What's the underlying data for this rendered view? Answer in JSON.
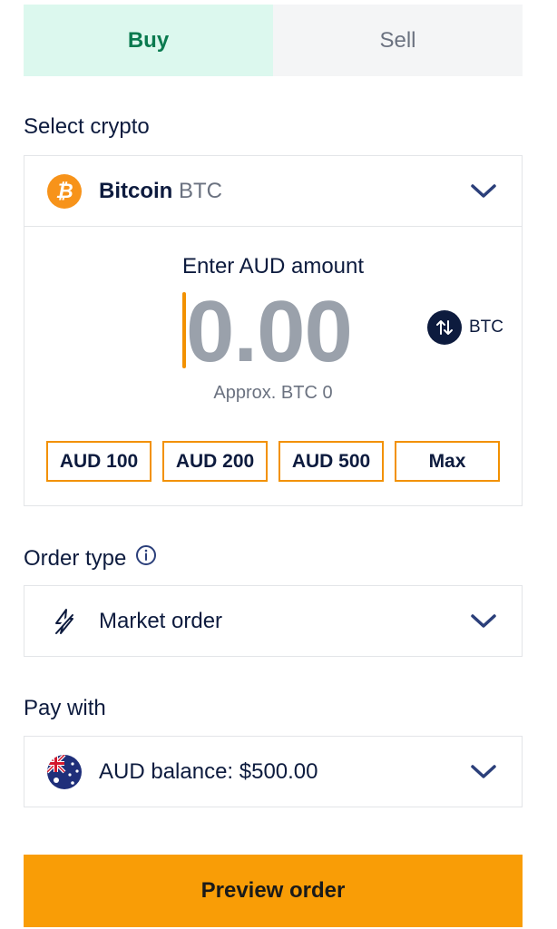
{
  "tabs": {
    "buy": "Buy",
    "sell": "Sell",
    "active": "buy"
  },
  "select_crypto": {
    "label": "Select crypto",
    "name": "Bitcoin",
    "symbol": "BTC",
    "icon": "bitcoin-icon"
  },
  "amount": {
    "label": "Enter AUD amount",
    "value": "0.00",
    "toggle_label": "BTC",
    "approx": "Approx. BTC 0",
    "quick_options": [
      "AUD 100",
      "AUD 200",
      "AUD 500",
      "Max"
    ]
  },
  "order_type": {
    "label": "Order type",
    "value": "Market order",
    "icon": "lightning-icon"
  },
  "pay_with": {
    "label": "Pay with",
    "value": "AUD balance: $500.00",
    "icon": "australia-flag-icon"
  },
  "preview_button": "Preview order",
  "colors": {
    "accent": "#f99d06",
    "buy_bg": "#dcf8ee",
    "buy_text": "#0a7a4f",
    "navy": "#0d1b3e",
    "bitcoin": "#f7931a"
  }
}
